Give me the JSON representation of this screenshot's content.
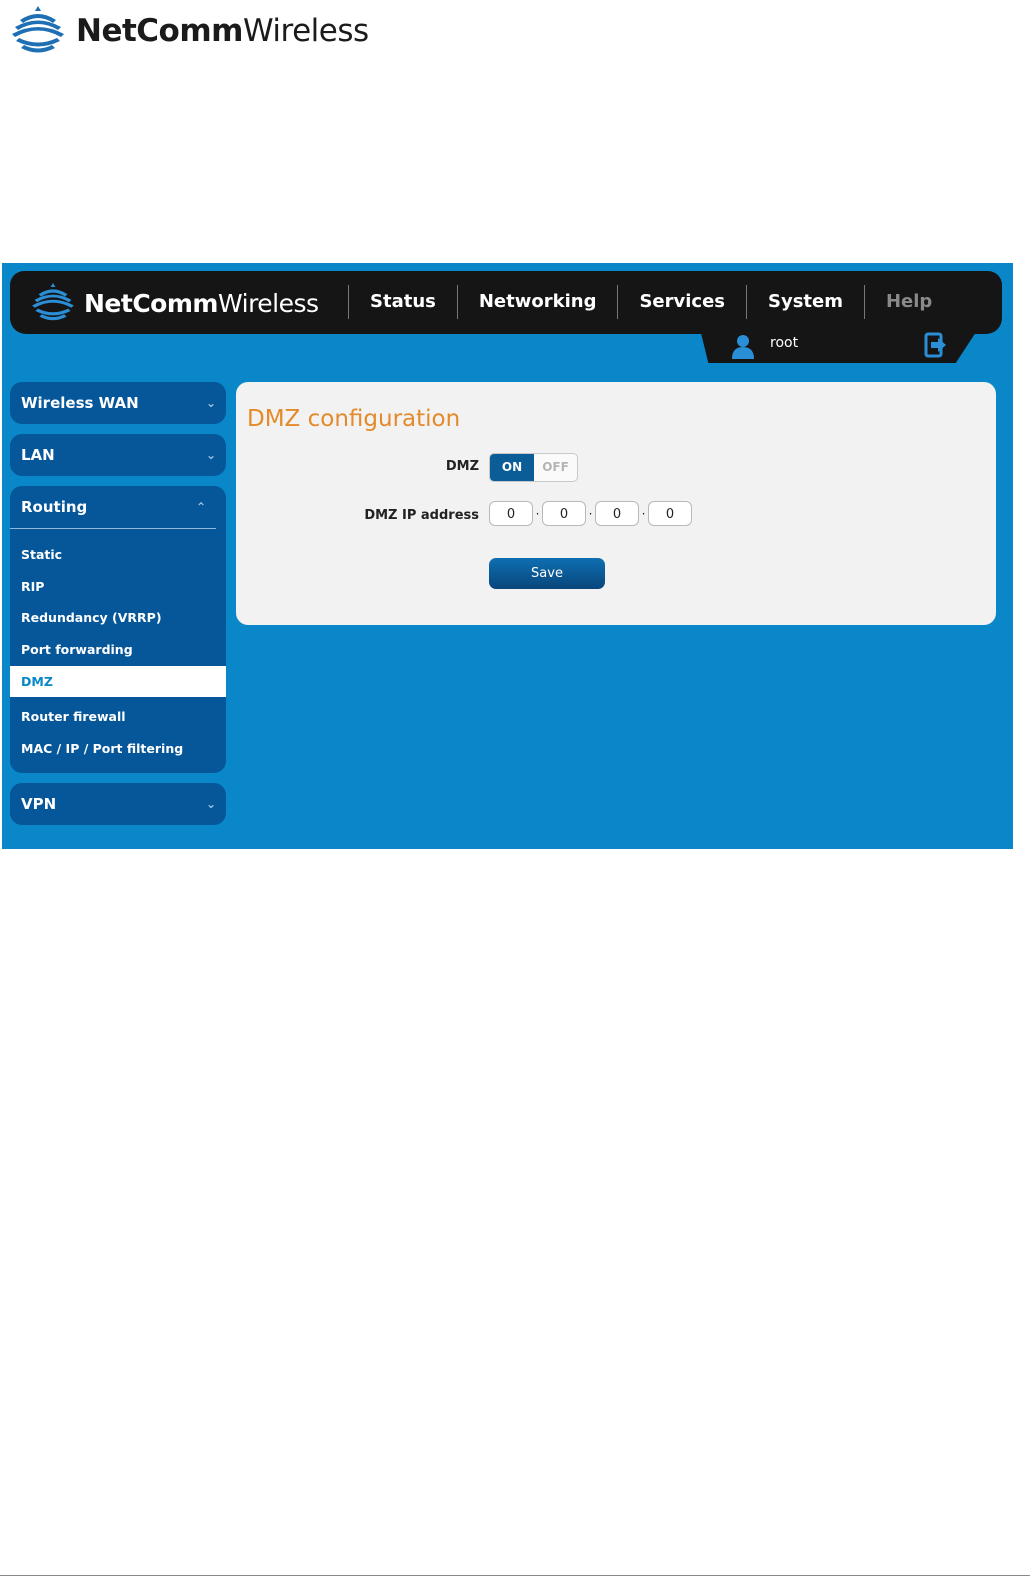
{
  "document": {
    "logo": {
      "bold": "NetComm",
      "regular": "Wireless",
      "icon": "wifi-signal-icon"
    }
  },
  "app": {
    "logo": {
      "bold": "NetComm",
      "regular": "Wireless",
      "icon": "wifi-signal-icon"
    },
    "nav": [
      {
        "label": "Status"
      },
      {
        "label": "Networking"
      },
      {
        "label": "Services"
      },
      {
        "label": "System"
      },
      {
        "label": "Help"
      }
    ],
    "user": {
      "name": "root",
      "icon": "user-icon",
      "logout_icon": "logout-icon"
    },
    "sidebar": {
      "wireless_wan": "Wireless WAN",
      "lan": "LAN",
      "routing": "Routing",
      "routing_items": [
        {
          "label": "Static"
        },
        {
          "label": "RIP"
        },
        {
          "label": "Redundancy (VRRP)"
        },
        {
          "label": "Port forwarding"
        },
        {
          "label": "DMZ"
        },
        {
          "label": "Router firewall"
        },
        {
          "label": "MAC / IP / Port filtering"
        }
      ],
      "vpn": "VPN"
    },
    "panel": {
      "title": "DMZ configuration",
      "dmz_label": "DMZ",
      "toggle_on": "ON",
      "toggle_off": "OFF",
      "ip_label": "DMZ IP address",
      "ip_octets": [
        "0",
        "0",
        "0",
        "0"
      ],
      "save_label": "Save"
    },
    "colors": {
      "accent": "#0a87c8",
      "sidebar": "#06579a",
      "title": "#e58a2a",
      "topbar": "#151515"
    }
  }
}
